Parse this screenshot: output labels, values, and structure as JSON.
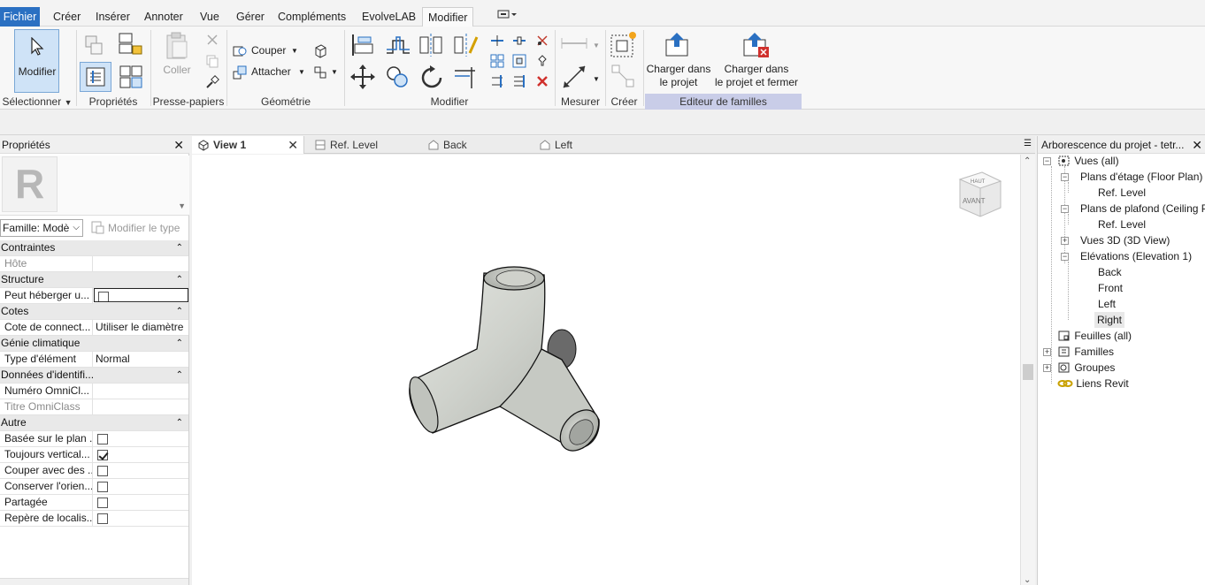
{
  "menu": {
    "file": "Fichier",
    "items": [
      "Créer",
      "Insérer",
      "Annoter",
      "Vue",
      "Gérer",
      "Compléments",
      "EvolveLAB",
      "Modifier"
    ]
  },
  "ribbon": {
    "modify_label": "Modifier",
    "coller_label": "Coller",
    "couper_label": "Couper",
    "attacher_label": "Attacher",
    "load_project": "Charger dans\nle projet",
    "load_project_close": "Charger dans\nle projet et fermer",
    "panels": {
      "select": "Sélectionner",
      "properties": "Propriétés",
      "clipboard": "Presse-papiers",
      "geometry": "Géométrie",
      "modify": "Modifier",
      "measure": "Mesurer",
      "create": "Créer",
      "family_editor": "Editeur de familles"
    }
  },
  "properties": {
    "title": "Propriétés",
    "family_select": "Famille: Modè",
    "edit_type": "Modifier le type",
    "groups": [
      {
        "name": "Contraintes",
        "rows": [
          {
            "name": "Hôte",
            "value": "",
            "dim": true
          }
        ]
      },
      {
        "name": "Structure",
        "rows": [
          {
            "name": "Peut héberger u...",
            "checkbox": false,
            "boxed": true
          }
        ]
      },
      {
        "name": "Cotes",
        "rows": [
          {
            "name": "Cote de connect...",
            "value": "Utiliser le diamètre"
          }
        ]
      },
      {
        "name": "Génie climatique",
        "rows": [
          {
            "name": "Type d'élément",
            "value": "Normal"
          }
        ]
      },
      {
        "name": "Données d'identifi...",
        "rows": [
          {
            "name": "Numéro OmniCl...",
            "value": ""
          },
          {
            "name": "Titre OmniClass",
            "value": "",
            "dim": true
          }
        ]
      },
      {
        "name": "Autre",
        "rows": [
          {
            "name": "Basée sur le plan ...",
            "checkbox": false
          },
          {
            "name": "Toujours vertical...",
            "checkbox": true
          },
          {
            "name": "Couper avec des ...",
            "checkbox": false
          },
          {
            "name": "Conserver l'orien...",
            "checkbox": false
          },
          {
            "name": "Partagée",
            "checkbox": false
          },
          {
            "name": "Repère de localis...",
            "checkbox": false
          }
        ]
      }
    ]
  },
  "tabs": [
    {
      "label": "View 1",
      "active": true
    },
    {
      "label": "Ref. Level"
    },
    {
      "label": "Back"
    },
    {
      "label": "Left"
    }
  ],
  "viewcube": {
    "top": "HAUT",
    "front": "AVANT"
  },
  "browser": {
    "title": "Arborescence du projet - tetr...",
    "nodes": {
      "views": "Vues (all)",
      "floor_plans": "Plans d'étage (Floor Plan)",
      "floor_ref": "Ref. Level",
      "ceiling_plans": "Plans de plafond (Ceiling P",
      "ceiling_ref": "Ref. Level",
      "views3d": "Vues 3D (3D View)",
      "elevations": "Elévations (Elevation 1)",
      "back": "Back",
      "front": "Front",
      "left": "Left",
      "right": "Right",
      "sheets": "Feuilles (all)",
      "families": "Familles",
      "groups": "Groupes",
      "links": "Liens Revit"
    }
  }
}
